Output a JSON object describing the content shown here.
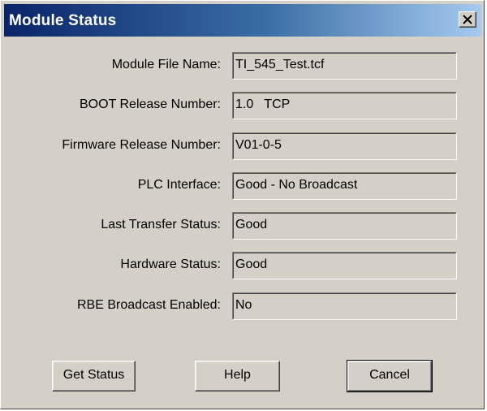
{
  "window": {
    "title": "Module Status",
    "close_icon": "close-icon"
  },
  "fields": [
    {
      "label": "Module File Name:",
      "value": "TI_545_Test.tcf"
    },
    {
      "label": "BOOT Release Number:",
      "value": "1.0   TCP"
    },
    {
      "label": "Firmware Release Number:",
      "value": "V01-0-5"
    },
    {
      "label": "PLC Interface:",
      "value": "Good - No Broadcast"
    },
    {
      "label": "Last Transfer Status:",
      "value": "Good"
    },
    {
      "label": "Hardware Status:",
      "value": "Good"
    },
    {
      "label": "RBE Broadcast Enabled:",
      "value": "No"
    }
  ],
  "buttons": {
    "get_status": "Get Status",
    "help": "Help",
    "cancel": "Cancel"
  },
  "colors": {
    "titlebar_start": "#0a246a",
    "titlebar_end": "#a6caf0",
    "face": "#d4d0c8"
  }
}
